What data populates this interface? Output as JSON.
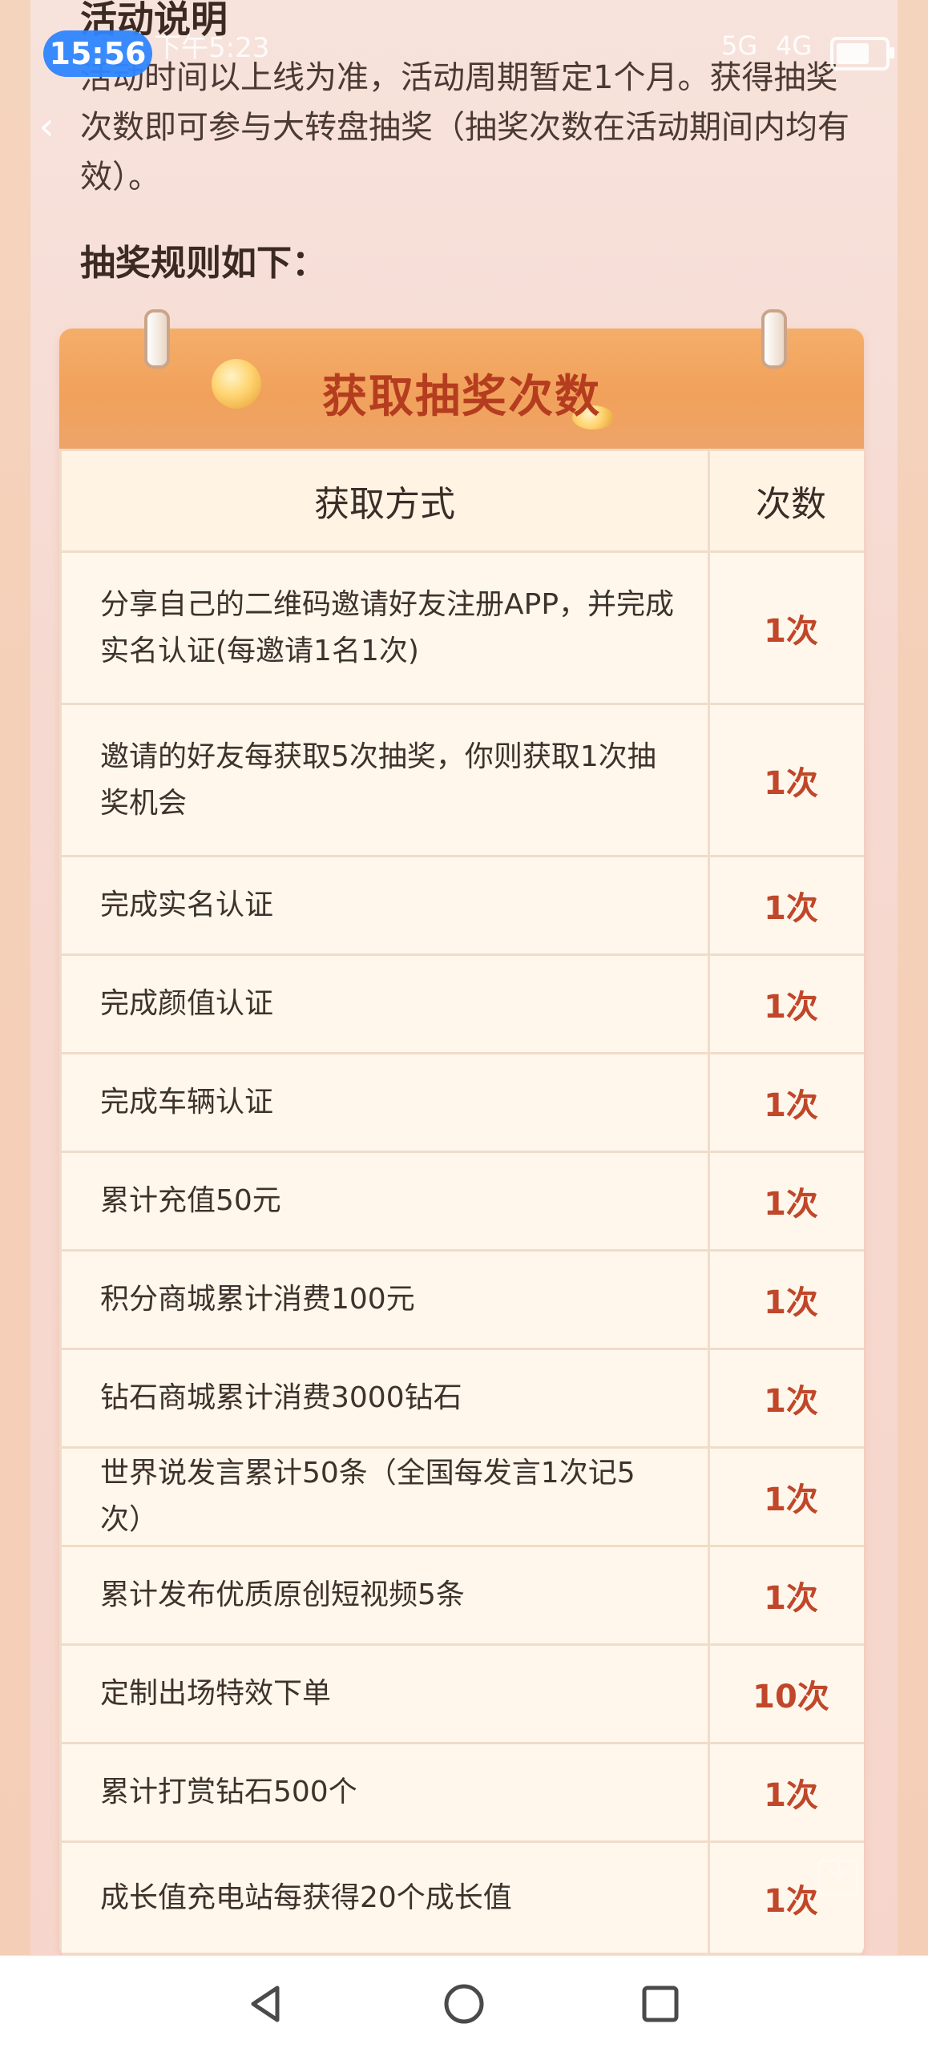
{
  "status_bar": {
    "time": "15:56",
    "secondary_time": "下午5:23",
    "battery_icon": "battery-icon",
    "signal_labels": [
      "5G",
      "4G"
    ]
  },
  "activity": {
    "section_title": "活动说明",
    "description": "活动时间以上线为准，活动周期暂定1个月。获得抽奖次数即可参与大转盘抽奖（抽奖次数在活动期间内均有效）。",
    "rules_title": "抽奖规则如下："
  },
  "card": {
    "title": "获取抽奖次数",
    "columns": [
      "获取方式",
      "次数"
    ],
    "rows": [
      {
        "method": "分享自己的二维码邀请好友注册APP，并完成实名认证(每邀请1名1次)",
        "count": "1次"
      },
      {
        "method": "邀请的好友每获取5次抽奖，你则获取1次抽奖机会",
        "count": "1次"
      },
      {
        "method": "完成实名认证",
        "count": "1次"
      },
      {
        "method": "完成颜值认证",
        "count": "1次"
      },
      {
        "method": "完成车辆认证",
        "count": "1次"
      },
      {
        "method": "累计充值50元",
        "count": "1次"
      },
      {
        "method": "积分商城累计消费100元",
        "count": "1次"
      },
      {
        "method": "钻石商城累计消费3000钻石",
        "count": "1次"
      },
      {
        "method": "世界说发言累计50条（全国每发言1次记5次）",
        "count": "1次"
      },
      {
        "method": "累计发布优质原创短视频5条",
        "count": "1次"
      },
      {
        "method": "定制出场特效下单",
        "count": "10次"
      },
      {
        "method": "累计打赏钻石500个",
        "count": "1次"
      },
      {
        "method": "成长值充电站每获得20个成长值",
        "count": "1次"
      }
    ]
  },
  "nav": {
    "back_icon": "triangle-back-icon",
    "home_icon": "circle-home-icon",
    "recent_icon": "square-recent-icon"
  },
  "colors": {
    "accent": "#c0472a",
    "header": "#f1a15b",
    "card_bg": "#fff7ec"
  }
}
